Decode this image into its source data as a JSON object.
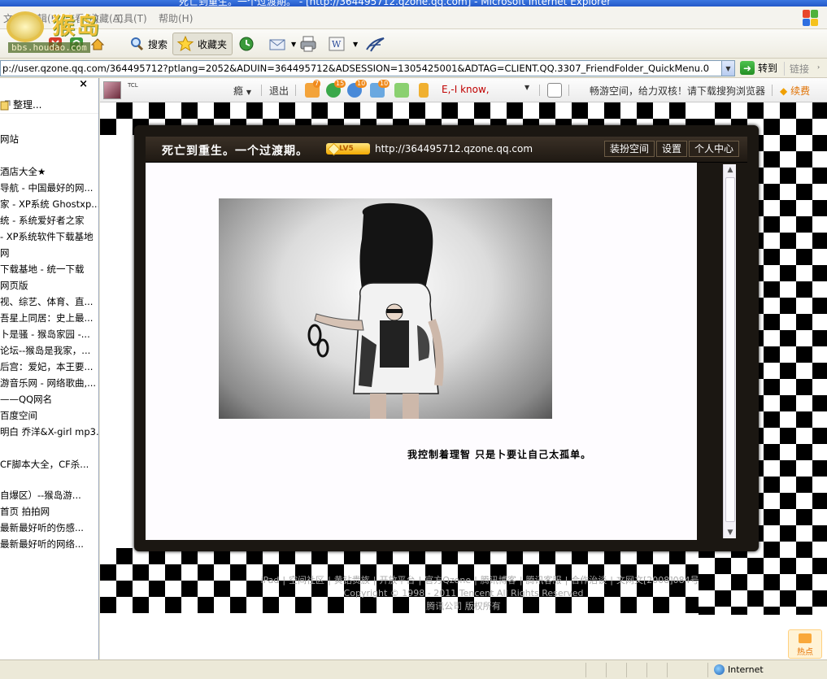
{
  "window": {
    "title": "死亡到重生。一个过渡期。 - [http://364495712.qzone.qq.com] - Microsoft Internet Explorer"
  },
  "menubar": {
    "items": [
      "文件(F)",
      "编辑(E)",
      "查看(V)",
      "收藏(A)",
      "工具(T)",
      "帮助(H)"
    ]
  },
  "watermark": {
    "name": "猴岛",
    "url": "bbs.houdao.com"
  },
  "toolbar": {
    "search": "搜索",
    "favorites": "收藏夹"
  },
  "address": {
    "url": "p://user.qzone.qq.com/364495712?ptlang=2052&ADUIN=364495712&ADSESSION=1305425001&ADTAG=CLIENT.QQ.3307_FriendFolder_QuickMenu.0",
    "go": "转到",
    "links": "链接"
  },
  "sidebar": {
    "close": "×",
    "organize": "整理...",
    "items": [
      "网站",
      "酒店大全★",
      "导航 - 中国最好的网...",
      "家 - XP系统 Ghostxp...",
      "统 - 系统爱好者之家",
      "- XP系统软件下载基地",
      "网",
      "下载基地 - 统一下载",
      "网页版",
      "视、综艺、体育、直...",
      "吾星上同居：史上最...",
      "卜是骚 - 猴岛家园 -...",
      "论坛--猴岛是我家，...",
      "后宫：爱妃，本王要...",
      "游音乐网 - 网络歌曲,...",
      "——QQ网名",
      "百度空间",
      "明白 乔洋&X-girl mp3...",
      "CF脚本大全，CF杀...",
      "自爆区）--猴岛游...",
      "首页 拍拍网",
      "最新最好听的伤感...",
      "最新最好听的网络..."
    ]
  },
  "qzone_bar": {
    "tcl": "TCL",
    "nick": "瘾",
    "logout": "退出",
    "badges": [
      "7",
      "15",
      "10",
      "10"
    ],
    "status": "E,-I know,",
    "promo": "畅游空间，给力双核！请下载搜狗浏览器",
    "renew": "续费"
  },
  "blog": {
    "title": "死亡到重生。一个过渡期。",
    "level": "LV5",
    "url": "http://364495712.qzone.qq.com",
    "buttons": [
      "装扮空间",
      "设置",
      "个人中心"
    ],
    "caption": "我控制着理智 只是卜要让自己太孤单。"
  },
  "footer": {
    "links": [
      "iPad",
      "空间社区",
      "黄钻贵族",
      "开放平台",
      "官方Qzone",
      "腾讯博客",
      "腾讯客服",
      "合作治谈",
      "文网文[2008]084号"
    ],
    "copyright": "Copyright © 1998 - 2011 Tencent All Rights Reserved",
    "company": "腾讯公司 版权所有"
  },
  "hot": {
    "label": "热点"
  },
  "status": {
    "zone": "Internet"
  }
}
